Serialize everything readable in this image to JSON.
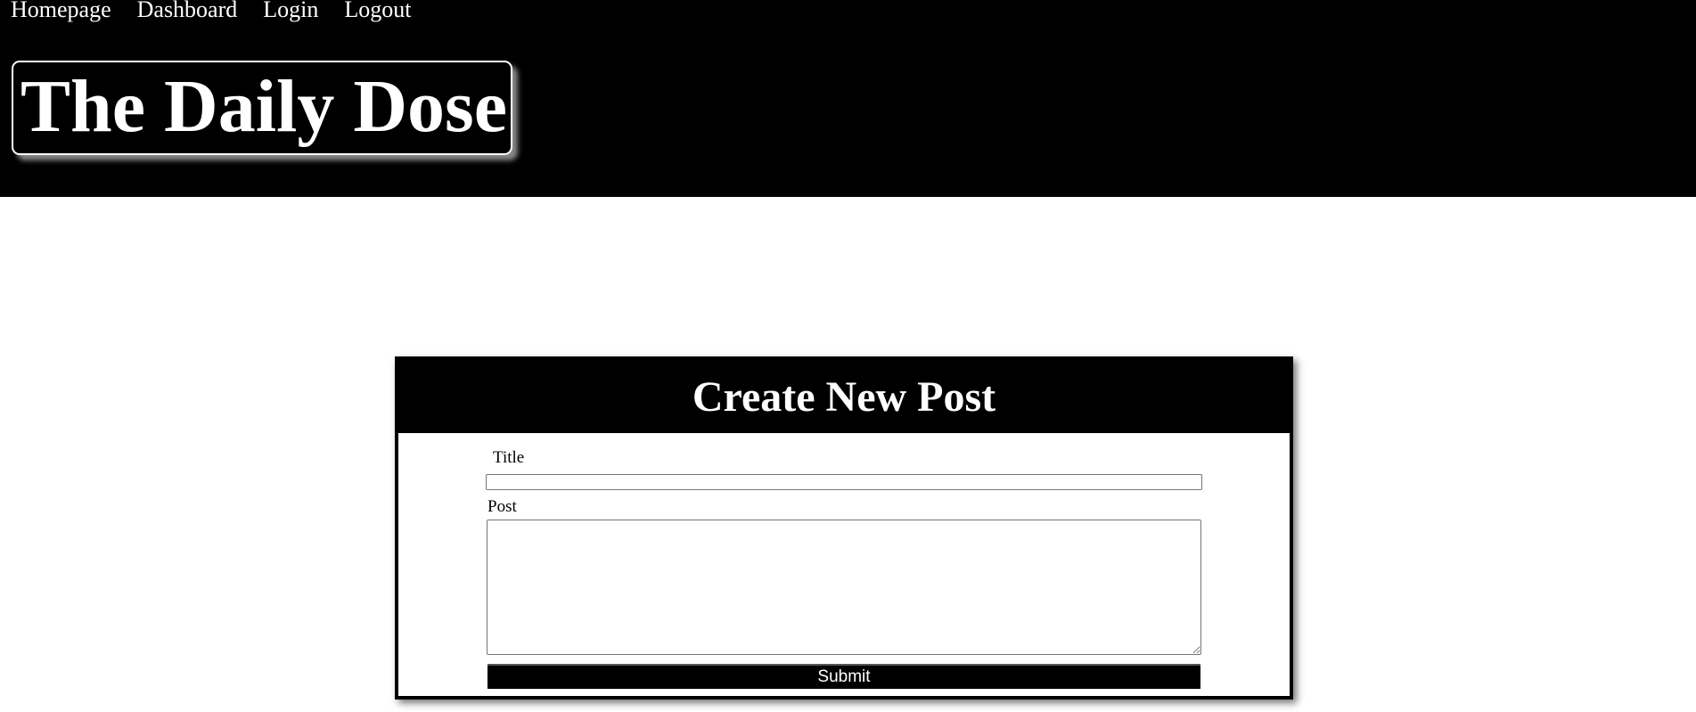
{
  "nav": {
    "items": [
      "Homepage",
      "Dashboard",
      "Login",
      "Logout"
    ]
  },
  "site_title": "The Daily Dose",
  "form": {
    "heading": "Create New Post",
    "title_label": "Title",
    "title_value": "",
    "post_label": "Post",
    "post_value": "",
    "submit_label": "Submit"
  }
}
